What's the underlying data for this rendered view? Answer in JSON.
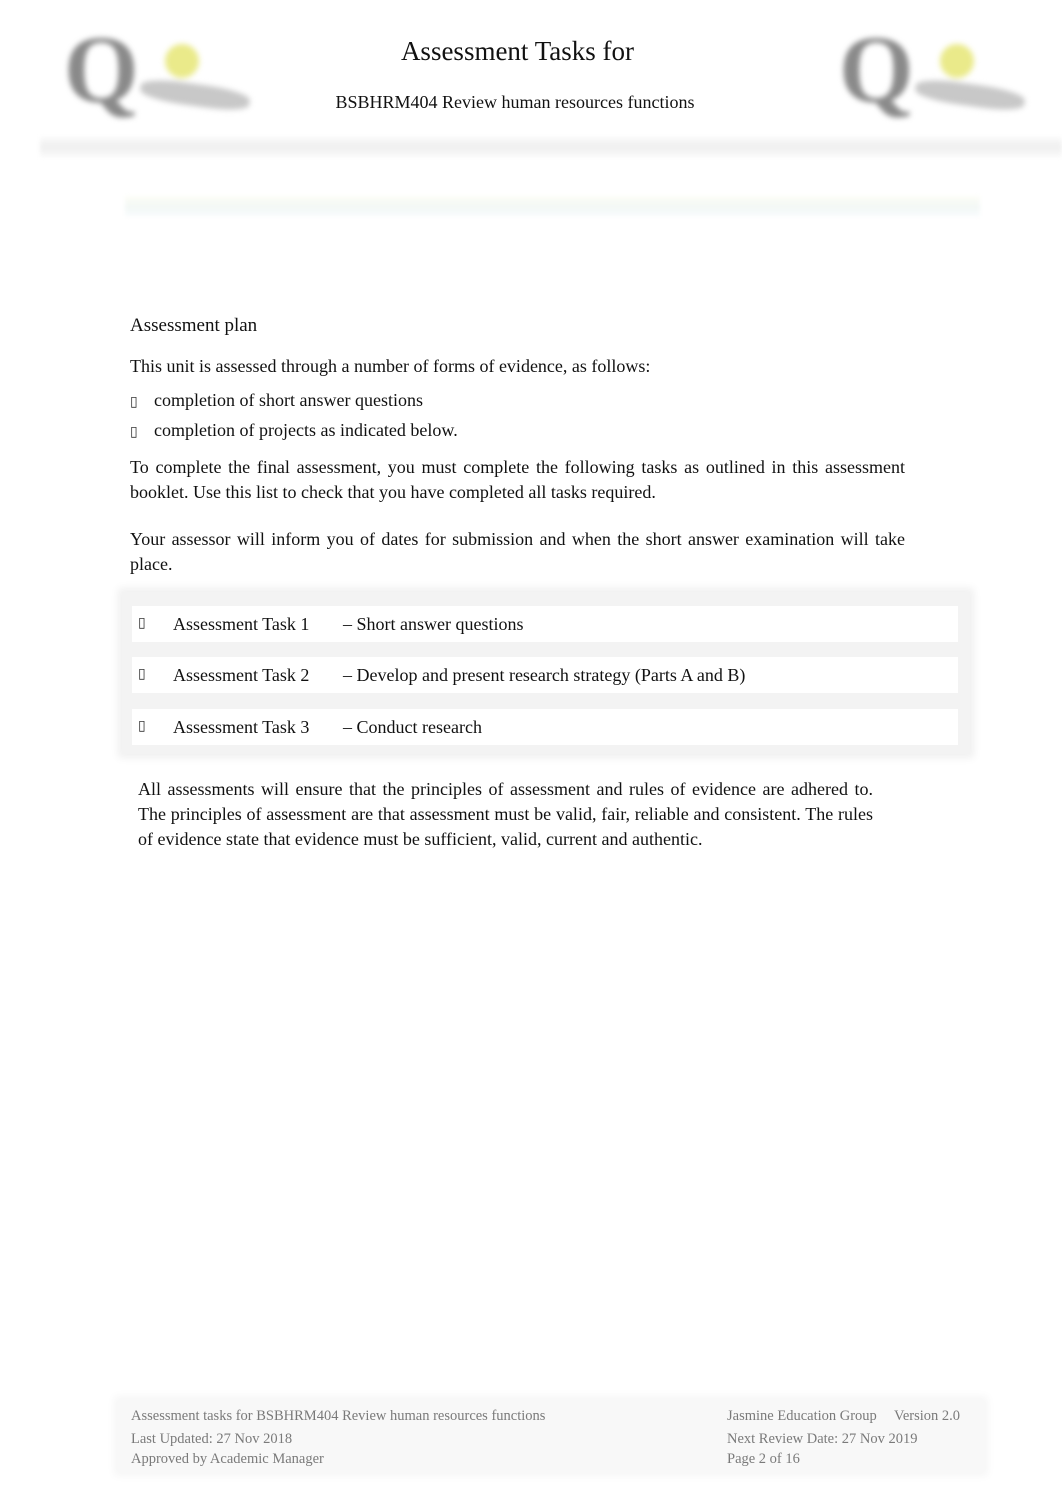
{
  "header": {
    "title": "Assessment Tasks for",
    "subtitle": "BSBHRM404 Review human resources functions",
    "logo_left": "Q",
    "logo_right": "Q"
  },
  "body": {
    "section_heading": "Assessment plan",
    "intro": "This unit is assessed through a number of forms of evidence, as follows:",
    "bullet_glyph": "▯",
    "bullets": [
      "completion of short answer questions",
      "completion of projects as indicated below."
    ],
    "instructions": "To complete the final assessment, you must complete the following tasks as outlined in this assessment booklet.   Use this list to check that you have completed all tasks required.",
    "assessor_note": "Your assessor will inform you of dates for submission and when the short answer examination will take place.",
    "tasks": [
      {
        "name": "Assessment Task 1",
        "description": "– Short answer questions"
      },
      {
        "name": "Assessment Task 2",
        "description": "– Develop and present research strategy (Parts A and B)"
      },
      {
        "name": "Assessment Task 3",
        "description": "– Conduct research"
      }
    ],
    "principles": "All assessments will ensure that the principles of assessment and rules of evidence are adhered to. The principles of assessment are that assessment must be valid, fair, reliable and consistent. The rules of evidence state that evidence must be sufficient, valid, current and authentic."
  },
  "footer": {
    "document_title": "Assessment tasks for  BSBHRM404 Review human resources functions",
    "last_updated": "Last Updated: 27 Nov 2018",
    "approved_by": "Approved  by Academic Manager",
    "organisation": "Jasmine Education Group",
    "version": "Version 2.0",
    "next_review": "Next Review Date: 27 Nov 2019",
    "page": "Page 2 of 16"
  }
}
